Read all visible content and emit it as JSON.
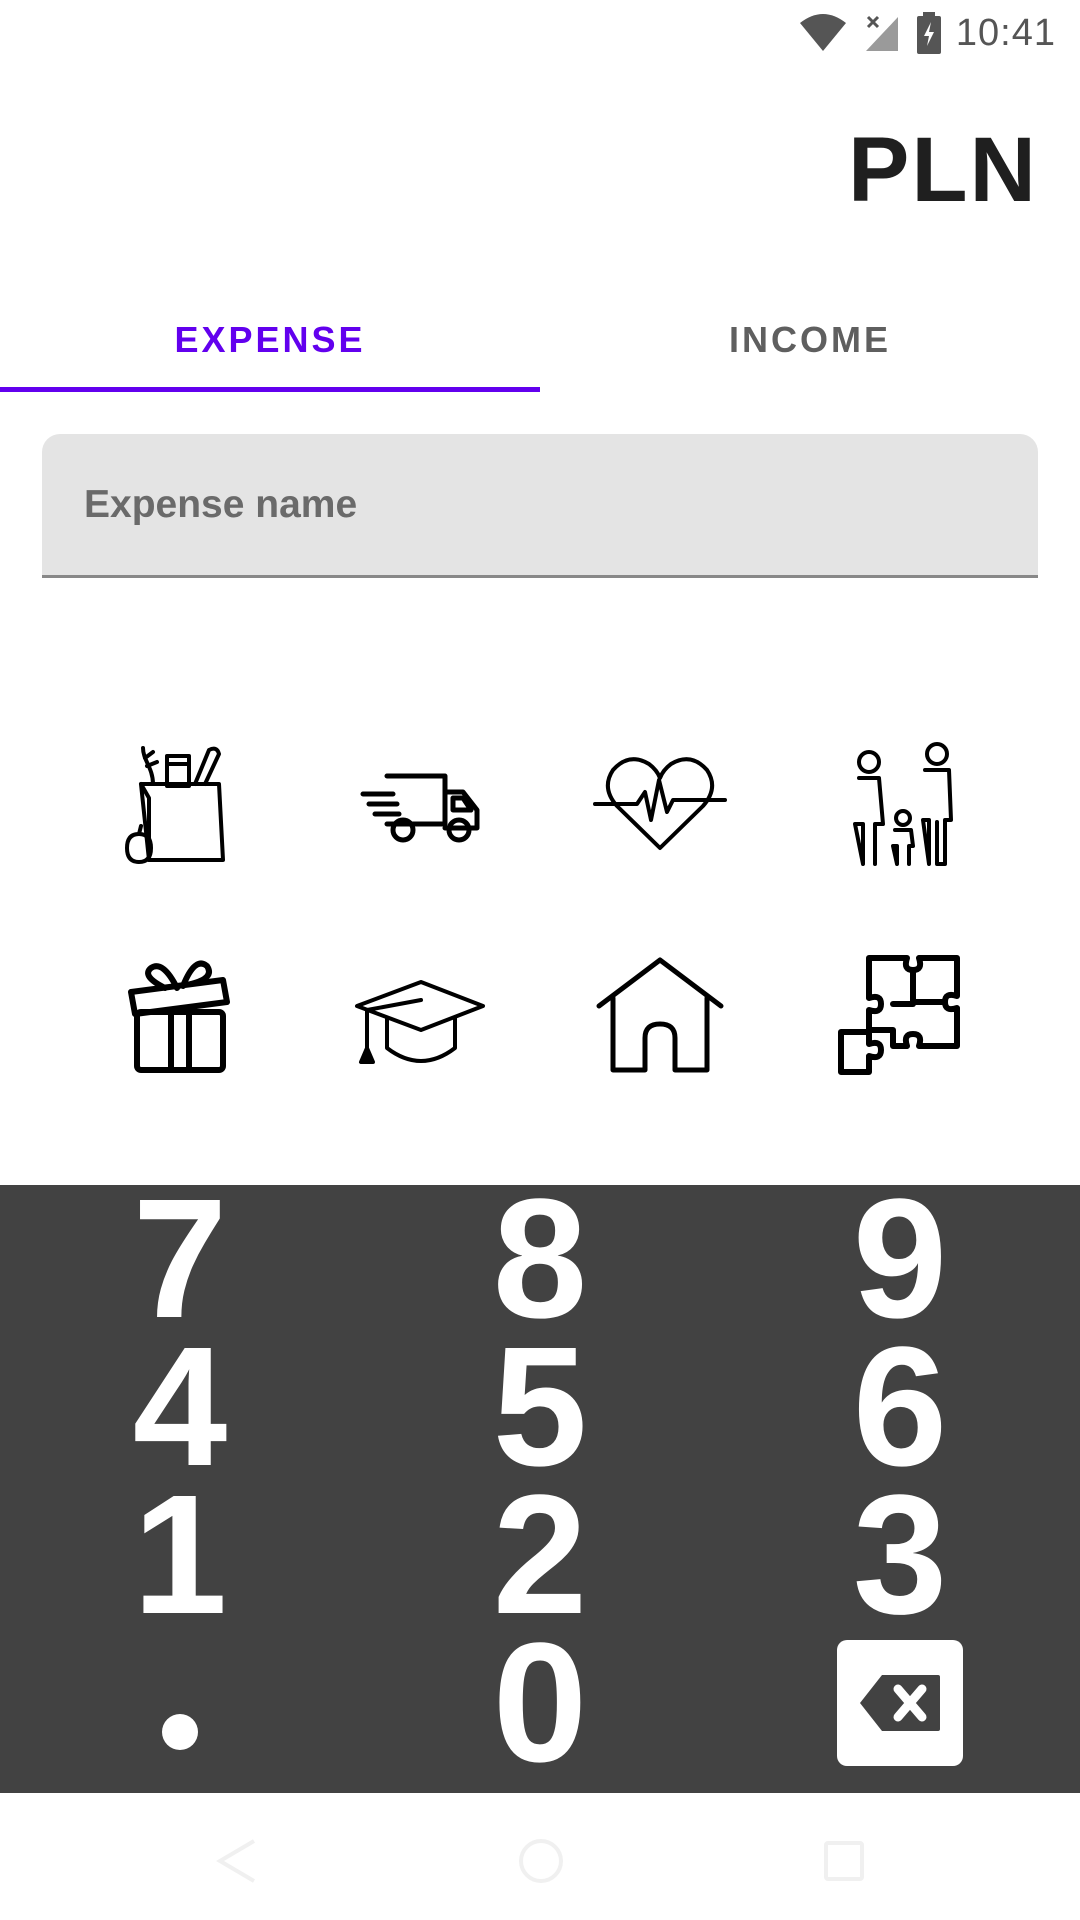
{
  "status_bar": {
    "time": "10:41",
    "icons": [
      "wifi-icon",
      "no-signal-icon",
      "battery-charging-icon"
    ]
  },
  "header": {
    "currency": "PLN"
  },
  "tabs": [
    {
      "label": "EXPENSE",
      "active": true
    },
    {
      "label": "INCOME",
      "active": false
    }
  ],
  "expense_name": {
    "placeholder": "Expense name",
    "value": ""
  },
  "categories": [
    "groceries-icon",
    "delivery-truck-icon",
    "health-heart-icon",
    "family-icon",
    "gift-icon",
    "graduation-cap-icon",
    "home-icon",
    "puzzle-icon"
  ],
  "keypad": {
    "rows": [
      [
        "7",
        "8",
        "9"
      ],
      [
        "4",
        "5",
        "6"
      ],
      [
        "1",
        "2",
        "3"
      ],
      [
        "dot",
        "0",
        "backspace"
      ]
    ]
  },
  "navigation": [
    "back-icon",
    "home-nav-icon",
    "recents-icon"
  ],
  "colors": {
    "accent": "#6200ee",
    "keypad_bg": "#424242",
    "input_bg": "#e4e4e4"
  }
}
